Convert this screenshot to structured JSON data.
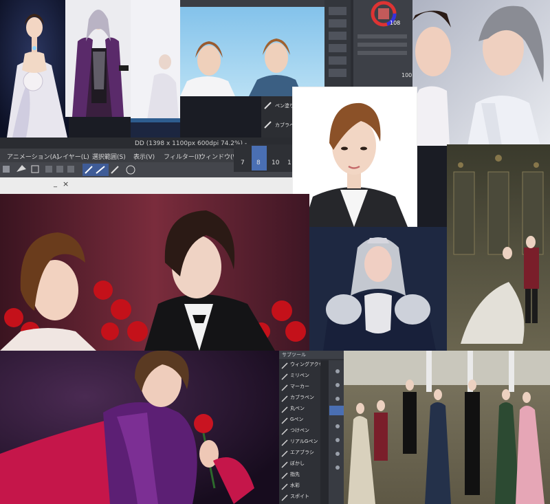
{
  "window": {
    "title": "DD (1398 x 1100px 600dpi 74.2%)",
    "title_suffix": " -",
    "min_glyph": "_",
    "close_glyph": "×"
  },
  "menu": [
    "アニメーション(A)",
    "レイヤー(L)",
    "選択範囲(S)",
    "表示(V)",
    "フィルター(I)",
    "ウィンドウ(W)"
  ],
  "brush_sizes": [
    "7",
    "8",
    "10",
    "1"
  ],
  "tool_panel_top": [
    "ペン塗り",
    "カブラペン"
  ],
  "tool_panel_bottom": {
    "header": "サブツール",
    "items": [
      "ウィングアクセス ペン",
      "ミリペン",
      "マーカー",
      "カブラペン",
      "丸ペン",
      "Gペン",
      "つけペン",
      "リアルGペン",
      "エアブラシ",
      "ぼかし",
      "指先",
      "水彩",
      "スポイト"
    ]
  },
  "color_readout": "108",
  "zoom_readout": "100",
  "icons": [
    "pen-icon",
    "hand-icon",
    "move-icon",
    "gradient-icon",
    "ruler-icon",
    "text-icon",
    "eraser-icon"
  ],
  "colors": {
    "accent": "#3d6fd6",
    "panel_dark": "#2b2d33",
    "toolbar": "#3b3d42"
  }
}
